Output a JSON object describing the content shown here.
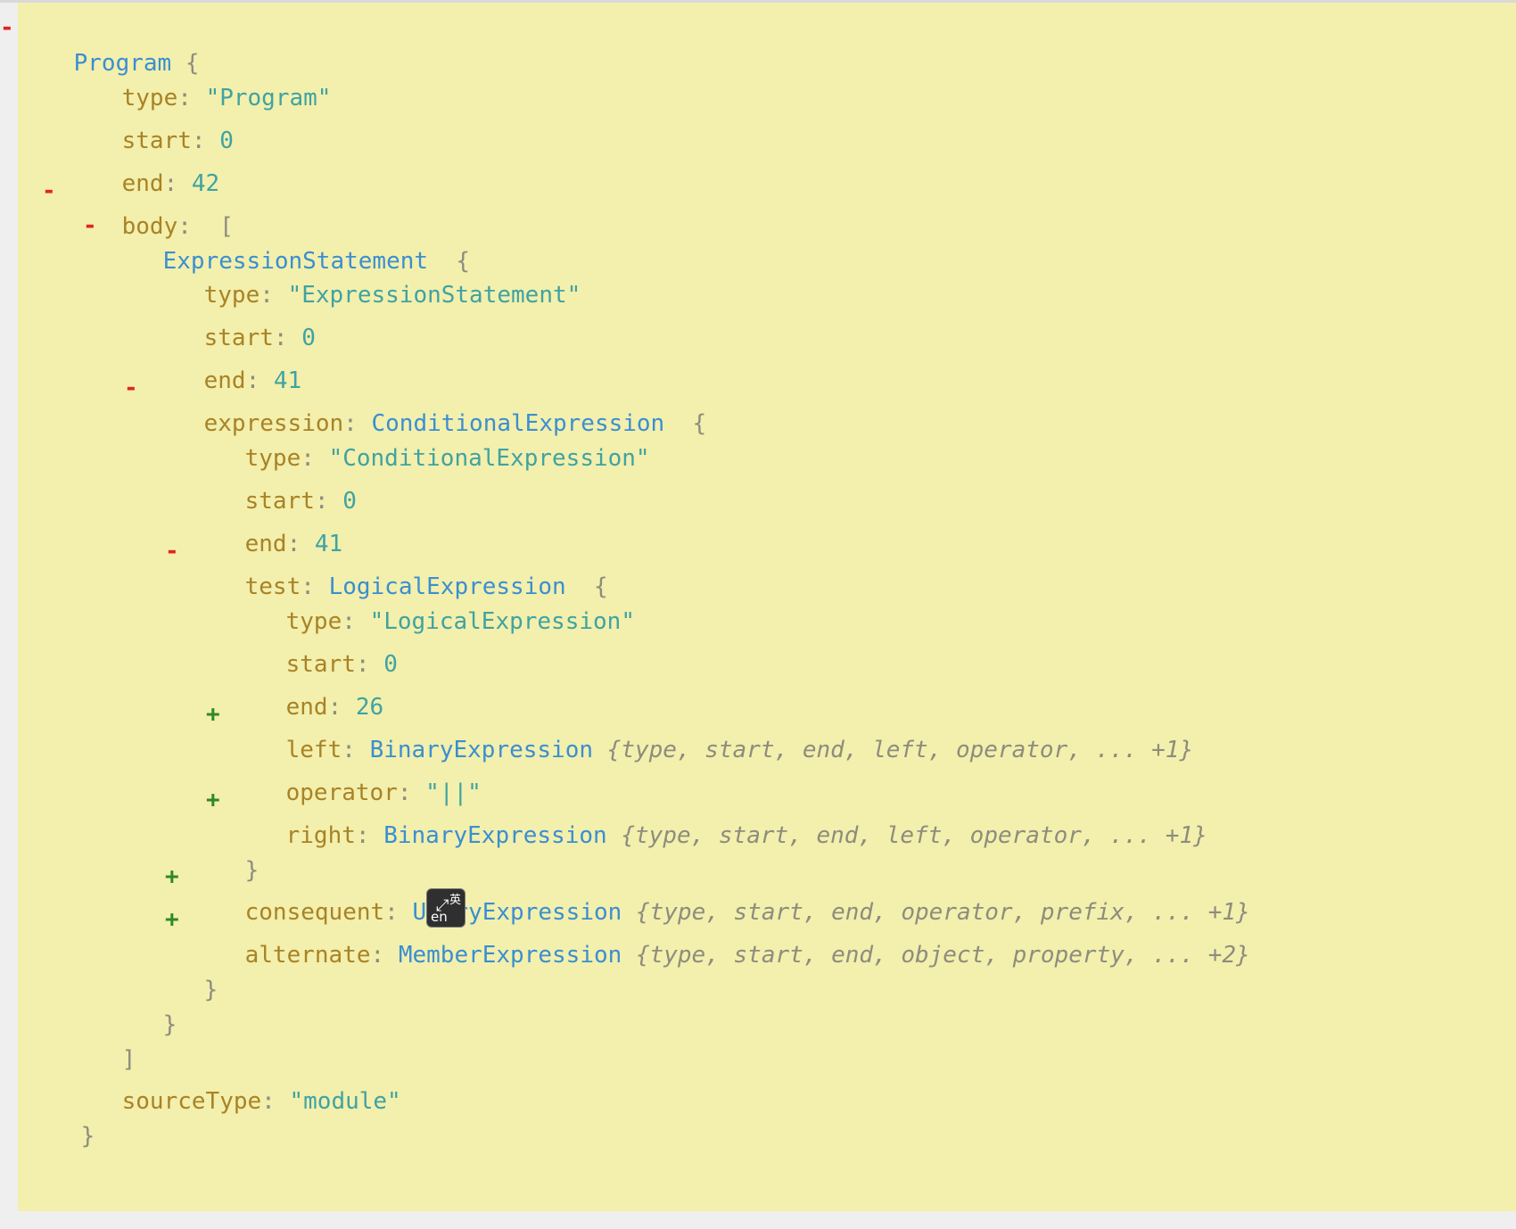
{
  "toggles": {
    "minus": "-",
    "plus": "+"
  },
  "sep": ": ",
  "brackets": {
    "open_brace": "{",
    "close_brace": "}",
    "open_bracket": "[",
    "close_bracket": "]"
  },
  "tree": {
    "root": {
      "type_name": "Program",
      "key_type": "type",
      "value_type": "\"Program\"",
      "key_start": "start",
      "value_start": "0",
      "key_end": "end",
      "value_end": "42",
      "key_sourcetype": "sourceType",
      "value_sourcetype": "\"module\""
    },
    "body": {
      "key": "body"
    },
    "statement": {
      "type_name": "ExpressionStatement",
      "key_type": "type",
      "value_type": "\"ExpressionStatement\"",
      "key_start": "start",
      "value_start": "0",
      "key_end": "end",
      "value_end": "41"
    },
    "expression": {
      "key": "expression",
      "type_name": "ConditionalExpression",
      "key_type": "type",
      "value_type": "\"ConditionalExpression\"",
      "key_start": "start",
      "value_start": "0",
      "key_end": "end",
      "value_end": "41"
    },
    "test": {
      "key": "test",
      "type_name": "LogicalExpression",
      "key_type": "type",
      "value_type": "\"LogicalExpression\"",
      "key_start": "start",
      "value_start": "0",
      "key_end": "end",
      "value_end": "26",
      "key_operator": "operator",
      "value_operator": "\"||\""
    },
    "left": {
      "key": "left",
      "type_name": "BinaryExpression",
      "summary": "{type, start, end, left, operator, ... +1}"
    },
    "right": {
      "key": "right",
      "type_name": "BinaryExpression",
      "summary": "{type, start, end, left, operator, ... +1}"
    },
    "consequent": {
      "key": "consequent",
      "type_name": "UnaryExpression",
      "summary": "{type, start, end, operator, prefix, ... +1}"
    },
    "alternate": {
      "key": "alternate",
      "type_name": "MemberExpression",
      "summary": "{type, start, end, object, property, ... +2}"
    }
  },
  "ime_badge": {
    "cn": "英",
    "en": "en",
    "icon": "ime-switch-icon"
  },
  "colors": {
    "panel_bg": "#f3efad",
    "key": "#a88325",
    "type_name": "#3a8fd0",
    "value": "#3fa3a1",
    "punct": "#8d8d7d",
    "collapse": "#e0261f",
    "expand": "#2f8a24"
  }
}
